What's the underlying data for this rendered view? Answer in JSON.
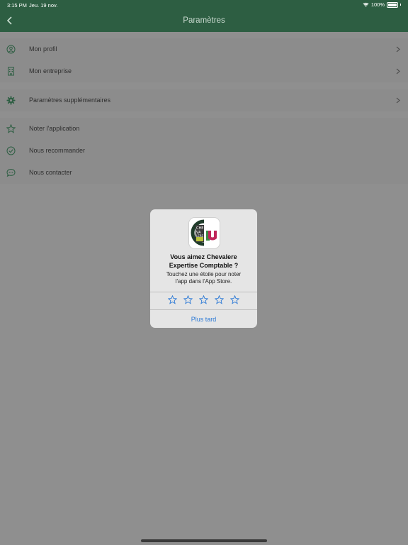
{
  "status_bar": {
    "time": "3:15 PM",
    "date": "Jeu. 19 nov.",
    "battery": "100%"
  },
  "header": {
    "title": "Paramètres"
  },
  "menu": {
    "profile": "Mon profil",
    "company": "Mon entreprise",
    "extra_settings": "Paramètres supplémentaires",
    "rate_app": "Noter l'application",
    "recommend": "Nous recommander",
    "contact": "Nous contacter"
  },
  "rating_dialog": {
    "title_line1": "Vous aimez Chevalere",
    "title_line2": "Expertise Comptable ?",
    "message_line1": "Touchez une étoile pour noter",
    "message_line2": "l'app dans l'App Store.",
    "later_button": "Plus tard",
    "star_count": 5,
    "selected_rating": 0
  },
  "colors": {
    "navbar": "#2d5e42",
    "overlay_background": "#8f8f8f",
    "accent_blue": "#2d7ad6",
    "icon_green": "#2d5e42"
  }
}
